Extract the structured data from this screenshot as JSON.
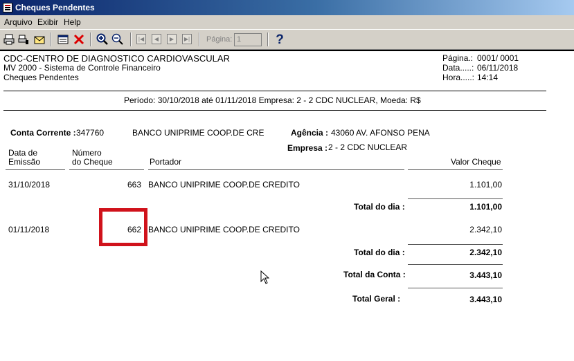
{
  "window": {
    "title": "Cheques Pendentes"
  },
  "menu": {
    "items": [
      "Arquivo",
      "Exibir",
      "Help"
    ]
  },
  "toolbar": {
    "page_label": "Página:",
    "page_value": "1",
    "help_glyph": "?"
  },
  "report": {
    "header_left": [
      "CDC-CENTRO DE DIAGNOSTICO CARDIOVASCULAR",
      "MV 2000 - Sistema de Controle Financeiro",
      "Cheques Pendentes"
    ],
    "header_right": {
      "pagina_label": "Página.:",
      "pagina_value": "0001/ 0001",
      "data_label": "Data.....:",
      "data_value": "06/11/2018",
      "hora_label": "Hora.....:",
      "hora_value": "14:14"
    },
    "periodo": "Período: 30/10/2018 até 01/11/2018  Empresa: 2 - 2 CDC NUCLEAR, Moeda: R$",
    "conta_label": "Conta Corrente :",
    "conta_value": "347760",
    "banco": "BANCO UNIPRIME COOP.DE CRE",
    "agencia_label": "Agência :",
    "agencia_value": "43060  AV. AFONSO PENA",
    "empresa_label": "Empresa :",
    "empresa_value": "2 - 2 CDC NUCLEAR",
    "columns": {
      "data_l1": "Data de",
      "data_l2": "Emissão",
      "num_l1": "Número",
      "num_l2": "do Cheque",
      "portador": "Portador",
      "valor": "Valor Cheque"
    },
    "rows": [
      {
        "data": "31/10/2018",
        "numero": "663",
        "portador": "BANCO UNIPRIME COOP.DE CREDITO",
        "valor": "1.101,00",
        "total_label": "Total do dia :",
        "total": "1.101,00"
      },
      {
        "data": "01/11/2018",
        "numero": "662",
        "portador": "BANCO UNIPRIME COOP.DE CREDITO",
        "valor": "2.342,10",
        "total_label": "Total do dia :",
        "total": "2.342,10"
      }
    ],
    "total_conta_label": "Total da Conta :",
    "total_conta": "3.443,10",
    "total_geral_label": "Total Geral :",
    "total_geral": "3.443,10"
  },
  "colors": {
    "titlebar": "#0a246a",
    "chrome": "#d4d0c8",
    "highlight": "#d0121b"
  }
}
